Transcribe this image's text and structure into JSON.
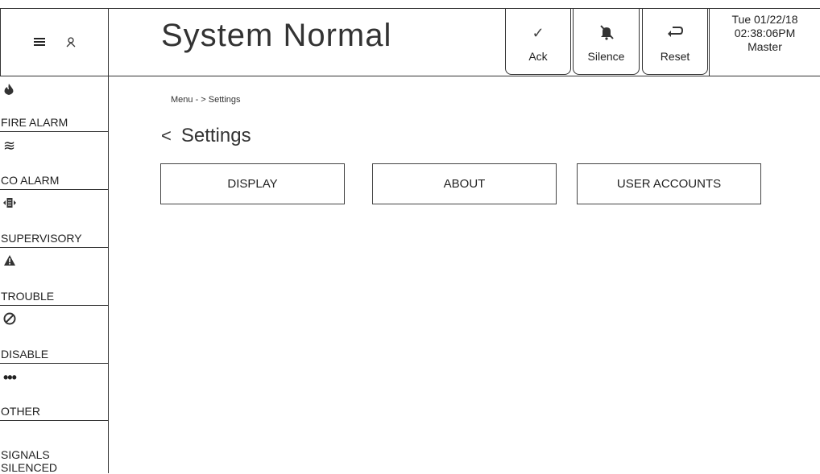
{
  "header": {
    "title": "System Normal",
    "ack_label": "Ack",
    "silence_label": "Silence",
    "reset_label": "Reset",
    "date": "Tue 01/22/18",
    "time": "02:38:06PM",
    "user": "Master"
  },
  "sidebar": {
    "items": [
      {
        "label": "FIRE ALARM",
        "icon": "flame-icon"
      },
      {
        "label": "CO ALARM",
        "icon": "co-waves-icon"
      },
      {
        "label": "SUPERVISORY",
        "icon": "supervisory-icon"
      },
      {
        "label": "TROUBLE",
        "icon": "warning-icon"
      },
      {
        "label": "DISABLE",
        "icon": "disable-icon"
      },
      {
        "label": "OTHER",
        "icon": "ellipsis-icon"
      },
      {
        "label": "SIGNALS SILENCED",
        "icon": ""
      }
    ]
  },
  "main": {
    "breadcrumb": "Menu - > Settings",
    "page_title": "Settings",
    "buttons": [
      "DISPLAY",
      "ABOUT",
      "USER ACCOUNTS"
    ]
  }
}
